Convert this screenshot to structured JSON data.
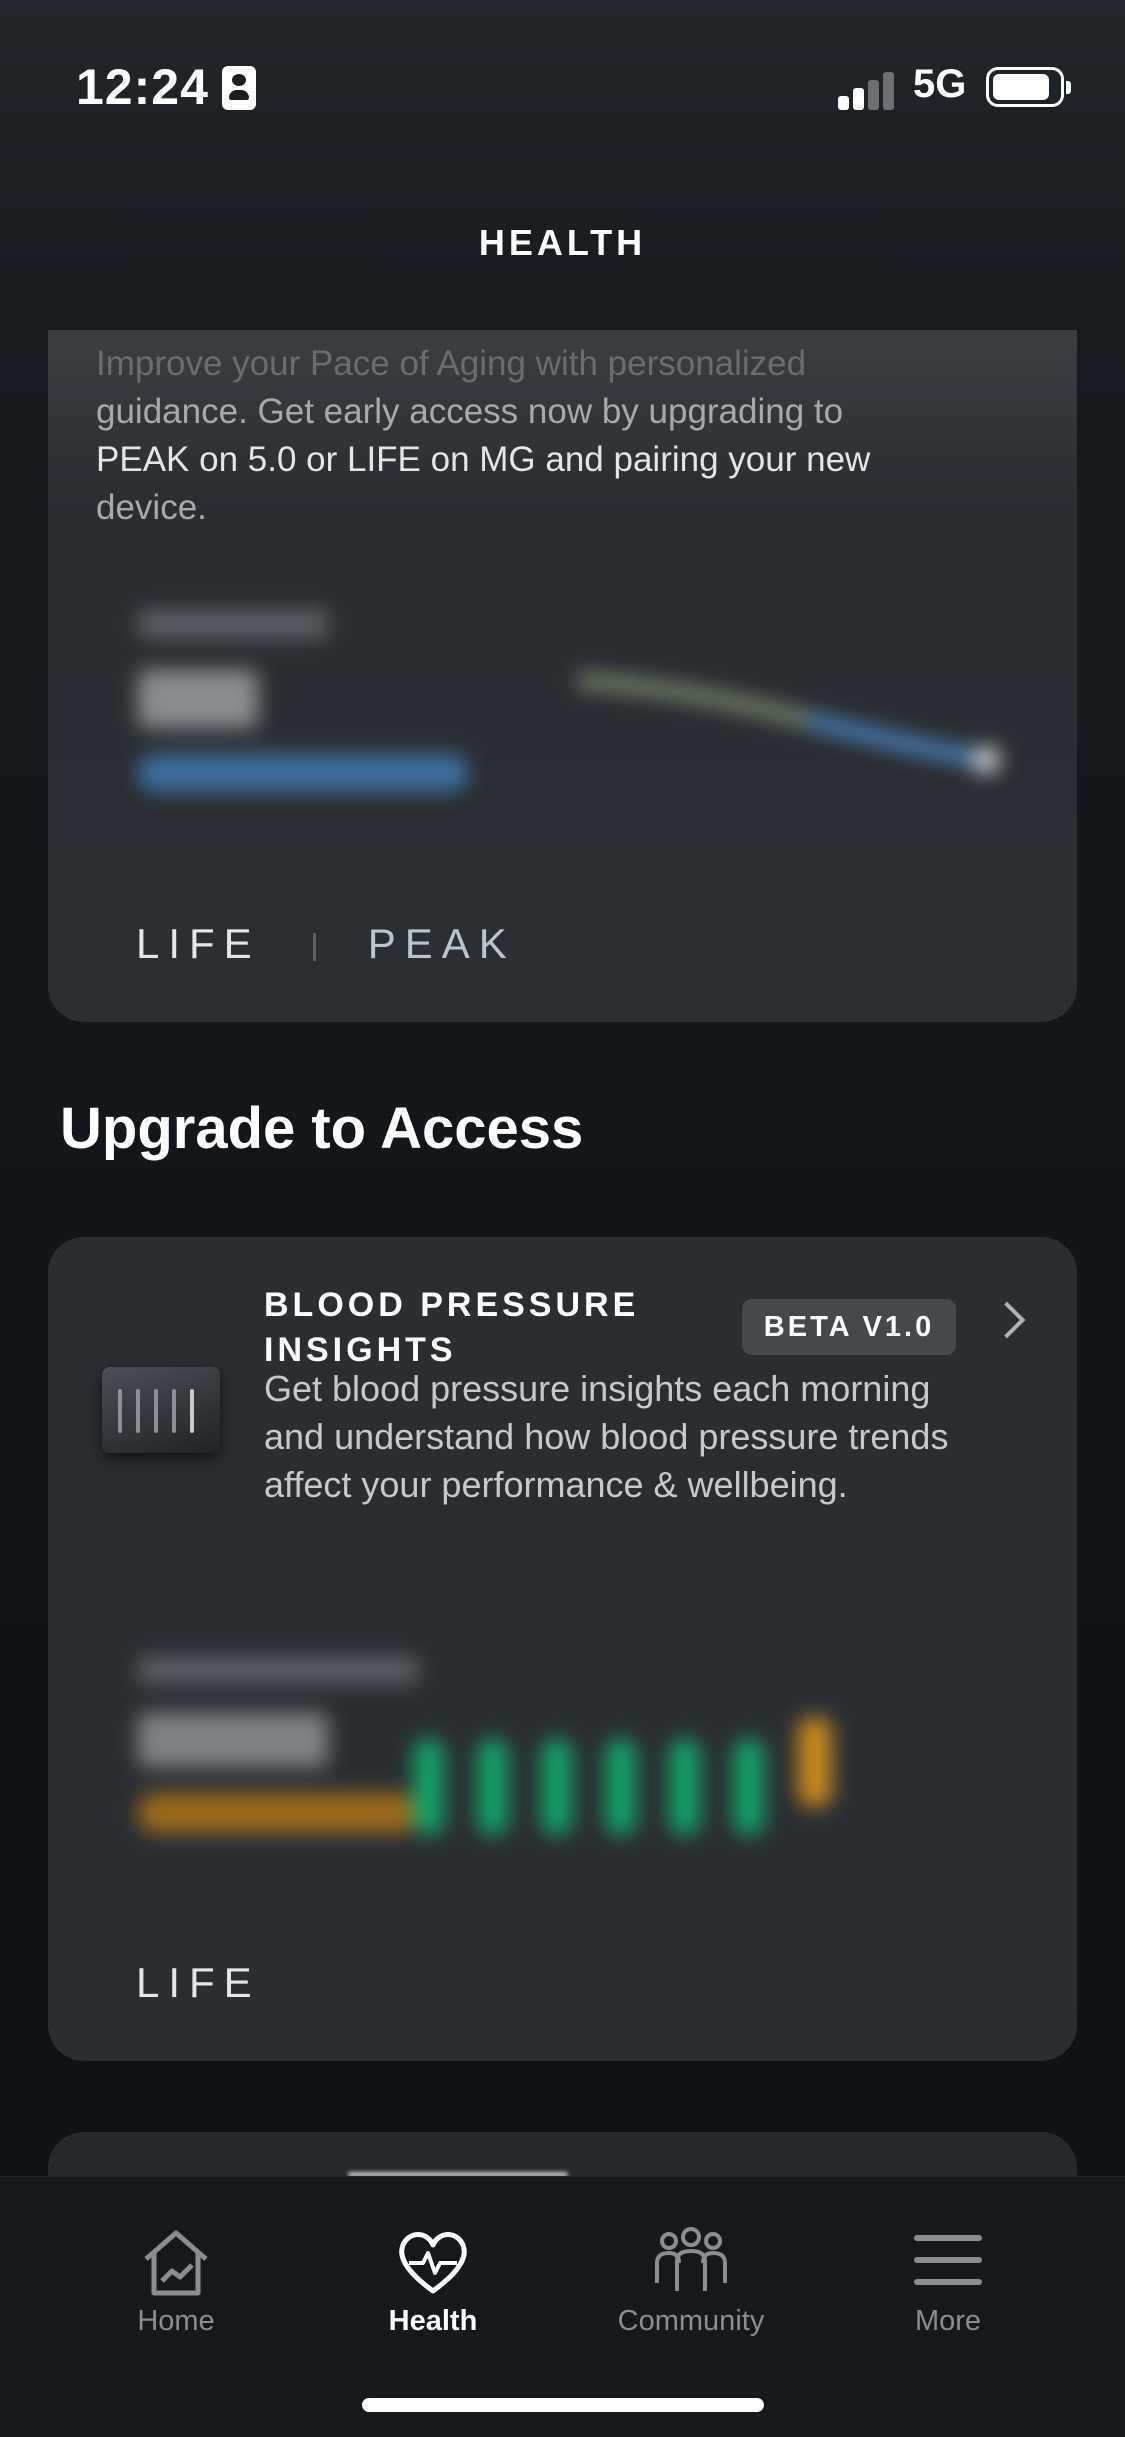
{
  "status_bar": {
    "time": "12:24",
    "network": "5G"
  },
  "header": {
    "title": "HEALTH"
  },
  "pace_card": {
    "text_top": "Improve your Pace of Aging with personalized",
    "text_line2": "guidance. Get early access now by upgrading to",
    "text_bold": "PEAK on 5.0 or LIFE on MG and pairing your new",
    "text_end": "device.",
    "tiers": [
      "LIFE",
      "PEAK"
    ]
  },
  "section": {
    "title": "Upgrade to Access"
  },
  "bp_card": {
    "title": "BLOOD PRESSURE INSIGHTS",
    "badge": "BETA V1.0",
    "description": "Get blood pressure insights each morning and understand how blood pressure trends affect your performance & wellbeing.",
    "tiers": [
      "LIFE"
    ]
  },
  "tab_bar": {
    "tabs": [
      {
        "label": "Home",
        "icon": "home-icon"
      },
      {
        "label": "Health",
        "icon": "heart-pulse-icon"
      },
      {
        "label": "Community",
        "icon": "people-icon"
      },
      {
        "label": "More",
        "icon": "menu-icon"
      }
    ],
    "active": "Health"
  },
  "colors": {
    "background": "#111519",
    "card": "#2a2e33",
    "badge": "#45494e",
    "green_bar": "#13a56a",
    "orange_bar": "#c98a1f",
    "blue_line": "#4b8bc9"
  }
}
